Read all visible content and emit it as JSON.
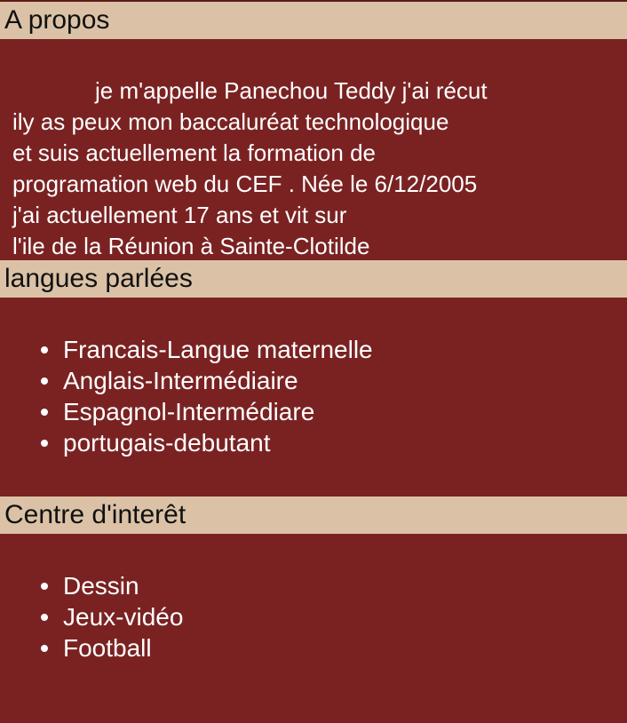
{
  "about": {
    "title": "A propos",
    "lines": [
      "je m'appelle Panechou Teddy j'ai récut",
      "ily as peux mon baccaluréat technologique",
      "et suis actuellement la formation de",
      "programation web du CEF . Née le 6/12/2005",
      "j'ai actuellement 17 ans et vit sur",
      "l'ile de la Réunion à Sainte-Clotilde"
    ]
  },
  "languages": {
    "title": "langues parlées",
    "items": [
      "Francais-Langue maternelle",
      "Anglais-Intermédiaire",
      "Espagnol-Intermédiare",
      "portugais-debutant"
    ]
  },
  "interests": {
    "title": "Centre d'interêt",
    "items": [
      "Dessin",
      "Jeux-vidéo",
      "Football"
    ]
  },
  "colors": {
    "background": "#7a2222",
    "header_background": "#dbc2a6",
    "header_text": "#111111",
    "body_text": "#ffffff"
  }
}
